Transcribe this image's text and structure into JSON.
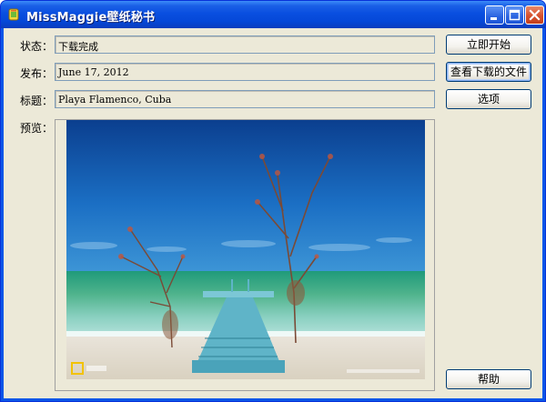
{
  "window": {
    "title": "MissMaggie壁纸秘书"
  },
  "fields": [
    {
      "label": "状态：",
      "value": "下载完成"
    },
    {
      "label": "发布：",
      "value": "June 17, 2012"
    },
    {
      "label": "标题：",
      "value": "Playa Flamenco, Cuba"
    }
  ],
  "preview": {
    "label": "预览："
  },
  "buttons": {
    "start": "立即开始",
    "view_downloads": "查看下载的文件",
    "options": "选项",
    "help": "帮助"
  },
  "icons": {
    "app": "app-icon",
    "minimize": "minimize-icon",
    "maximize": "maximize-icon",
    "close": "close-icon"
  }
}
